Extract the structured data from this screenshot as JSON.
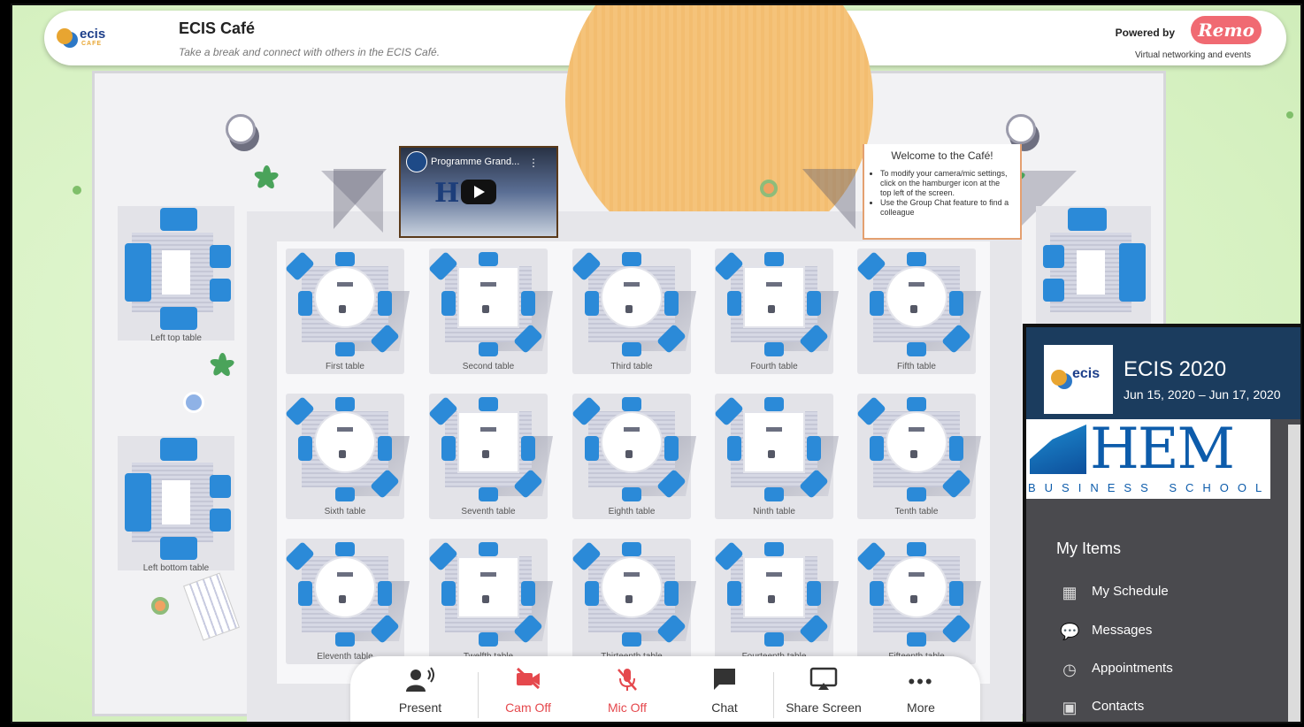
{
  "header": {
    "title": "ECIS Café",
    "subtitle": "Take a break and connect with others in the ECIS Café.",
    "logo_text": "ecis",
    "logo_sub": "CAFE",
    "powered_by": "Powered by",
    "brand": "Remo",
    "tagline": "Virtual networking and events"
  },
  "video": {
    "title": "Programme Grand...",
    "menu": "⋮",
    "logo_text": "H  M"
  },
  "welcome": {
    "heading": "Welcome to the Café!",
    "items": [
      "To modify your camera/mic settings, click on the hamburger icon at the top left of the screen.",
      "Use the Group Chat feature to find a colleague"
    ]
  },
  "tables": [
    "First table",
    "Second table",
    "Third table",
    "Fourth table",
    "Fifth table",
    "Sixth table",
    "Seventh table",
    "Eighth table",
    "Ninth table",
    "Tenth table",
    "Eleventh table",
    "Twelfth table",
    "Thirteenth table",
    "Fourteenth table",
    "Fifteenth table"
  ],
  "side_tables": {
    "left_top": "Left top table",
    "left_bottom": "Left bottom table"
  },
  "toolbar": {
    "present": "Present",
    "cam": "Cam Off",
    "mic": "Mic Off",
    "chat": "Chat",
    "share": "Share Screen",
    "more": "More"
  },
  "panel": {
    "logo_text": "ecis",
    "event_name": "ECIS 2020",
    "event_dates": "Jun 15, 2020 – Jun 17, 2020",
    "hem_word": "HEM",
    "hem_sub": "BUSINESS SCHOOL",
    "my_items": "My Items",
    "menu": [
      {
        "label": "My Schedule",
        "icon": "calendar-plus-icon"
      },
      {
        "label": "Messages",
        "icon": "chat-bubbles-icon"
      },
      {
        "label": "Appointments",
        "icon": "calendar-clock-icon"
      },
      {
        "label": "Contacts",
        "icon": "contact-card-icon"
      }
    ]
  },
  "colors": {
    "accent_blue": "#2b8ad8",
    "remo_pink": "#f06a72",
    "alert_red": "#e5484d",
    "panel_navy": "#1b3c5e"
  }
}
